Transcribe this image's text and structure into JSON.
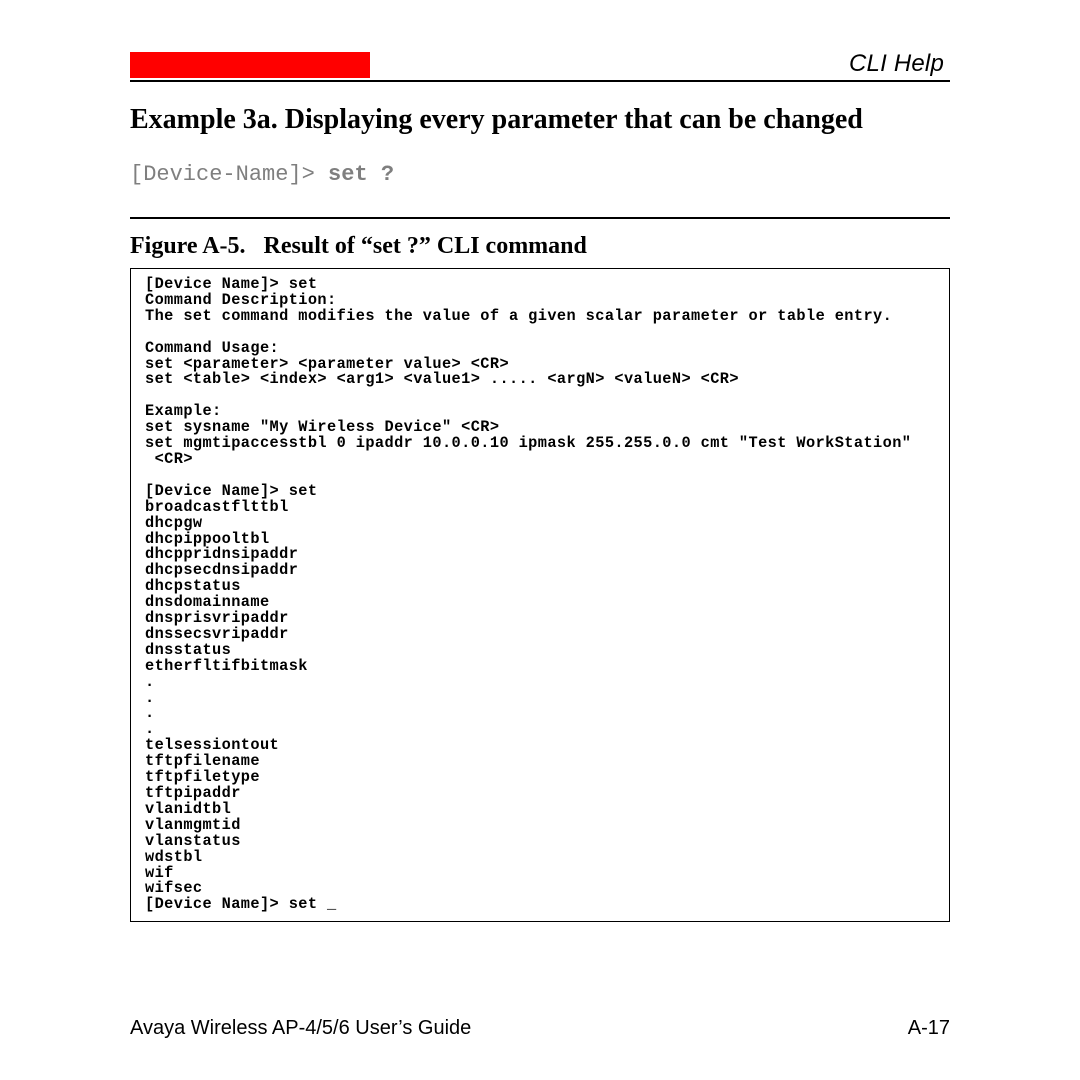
{
  "header": {
    "section_title": "CLI Help"
  },
  "heading": "Example 3a. Displaying every parameter that can be changed",
  "cli": {
    "prompt": "[Device-Name]> ",
    "command": "set ?"
  },
  "figure": {
    "label": "Figure A-5.",
    "title": "Result of “set ?” CLI command"
  },
  "terminal": "[Device Name]> set\nCommand Description:\nThe set command modifies the value of a given scalar parameter or table entry.\n\nCommand Usage:\nset <parameter> <parameter value> <CR>\nset <table> <index> <arg1> <value1> ..... <argN> <valueN> <CR>\n\nExample:\nset sysname \"My Wireless Device\" <CR>\nset mgmtipaccesstbl 0 ipaddr 10.0.0.10 ipmask 255.255.0.0 cmt \"Test WorkStation\"\n <CR>\n\n[Device Name]> set\nbroadcastflttbl\ndhcpgw\ndhcpippooltbl\ndhcppridnsipaddr\ndhcpsecdnsipaddr\ndhcpstatus\ndnsdomainname\ndnsprisvripaddr\ndnssecsvripaddr\ndnsstatus\netherfltifbitmask\n.\n.\n.\n.\ntelsessiontout\ntftpfilename\ntftpfiletype\ntftpipaddr\nvlanidtbl\nvlanmgmtid\nvlanstatus\nwdstbl\nwif\nwifsec\n[Device Name]> set _",
  "footer": {
    "left": "Avaya Wireless AP-4/5/6 User’s Guide",
    "right": "A-17"
  }
}
